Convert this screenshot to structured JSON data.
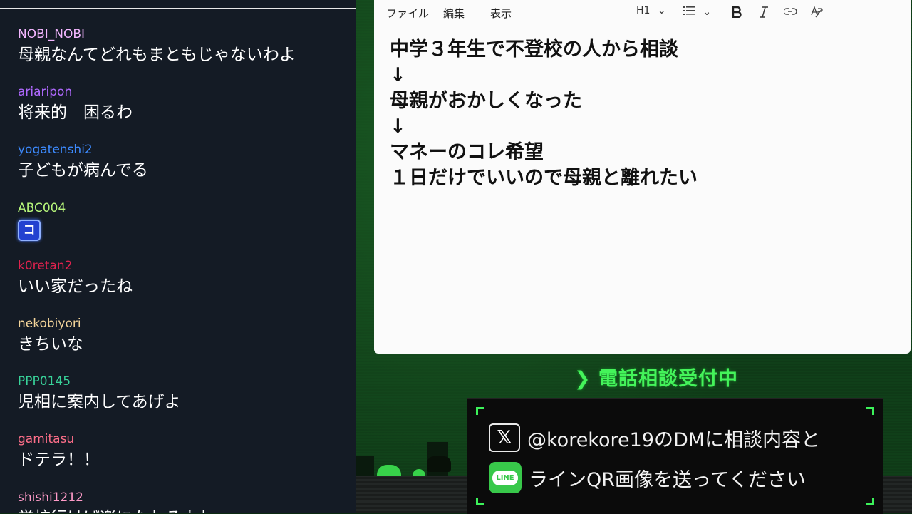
{
  "chat": {
    "messages": [
      {
        "user": "NOBI_NOBI",
        "text": "母親なんてどれもまともじゃないわよ",
        "color": "#f3b6ff"
      },
      {
        "user": "ariaripon",
        "text": "将来的　困るわ",
        "color": "#b069ff"
      },
      {
        "user": "yogatenshi2",
        "text": "子どもが病んでる",
        "color": "#3d8bff"
      },
      {
        "user": "ABC004",
        "stamp": "コ",
        "color": "#b6f57a"
      },
      {
        "user": "k0retan2",
        "text": "いい家だったね",
        "color": "#e0224e"
      },
      {
        "user": "nekobiyori",
        "text": "きちいな",
        "color": "#f4d59a"
      },
      {
        "user": "PPP0145",
        "text": "児相に案内してあげよ",
        "color": "#38d39a"
      },
      {
        "user": "gamitasu",
        "text": "ドテラ！！",
        "color": "#ff6f8a"
      },
      {
        "user": "shishi1212",
        "text": "学校行けば楽になれるよね",
        "color": "#ff9bc8"
      }
    ]
  },
  "editor": {
    "menu": {
      "file": "ファイル",
      "edit": "編集",
      "view": "表示"
    },
    "toolbar": {
      "heading": "H1",
      "heading_chevron": "⌄",
      "list_chevron": "⌄"
    },
    "lines": [
      "中学３年生で不登校の人から相談",
      "↓",
      "母親がおかしくなった",
      "↓",
      "マネーのコレ希望",
      "１日だけでいいので母親と離れたい"
    ]
  },
  "overlay": {
    "phone_title": "❯ 電話相談受付中",
    "x_line": "@korekore19のDMに相談内容と",
    "line_line": "ラインQR画像を送ってください",
    "x_logo": "𝕏",
    "line_logo": "LINE",
    "accent_color": "#3cf25a"
  },
  "icons": [
    "list-icon",
    "bold-icon",
    "italic-icon",
    "link-icon",
    "spellcheck-icon",
    "x-logo",
    "line-logo"
  ]
}
